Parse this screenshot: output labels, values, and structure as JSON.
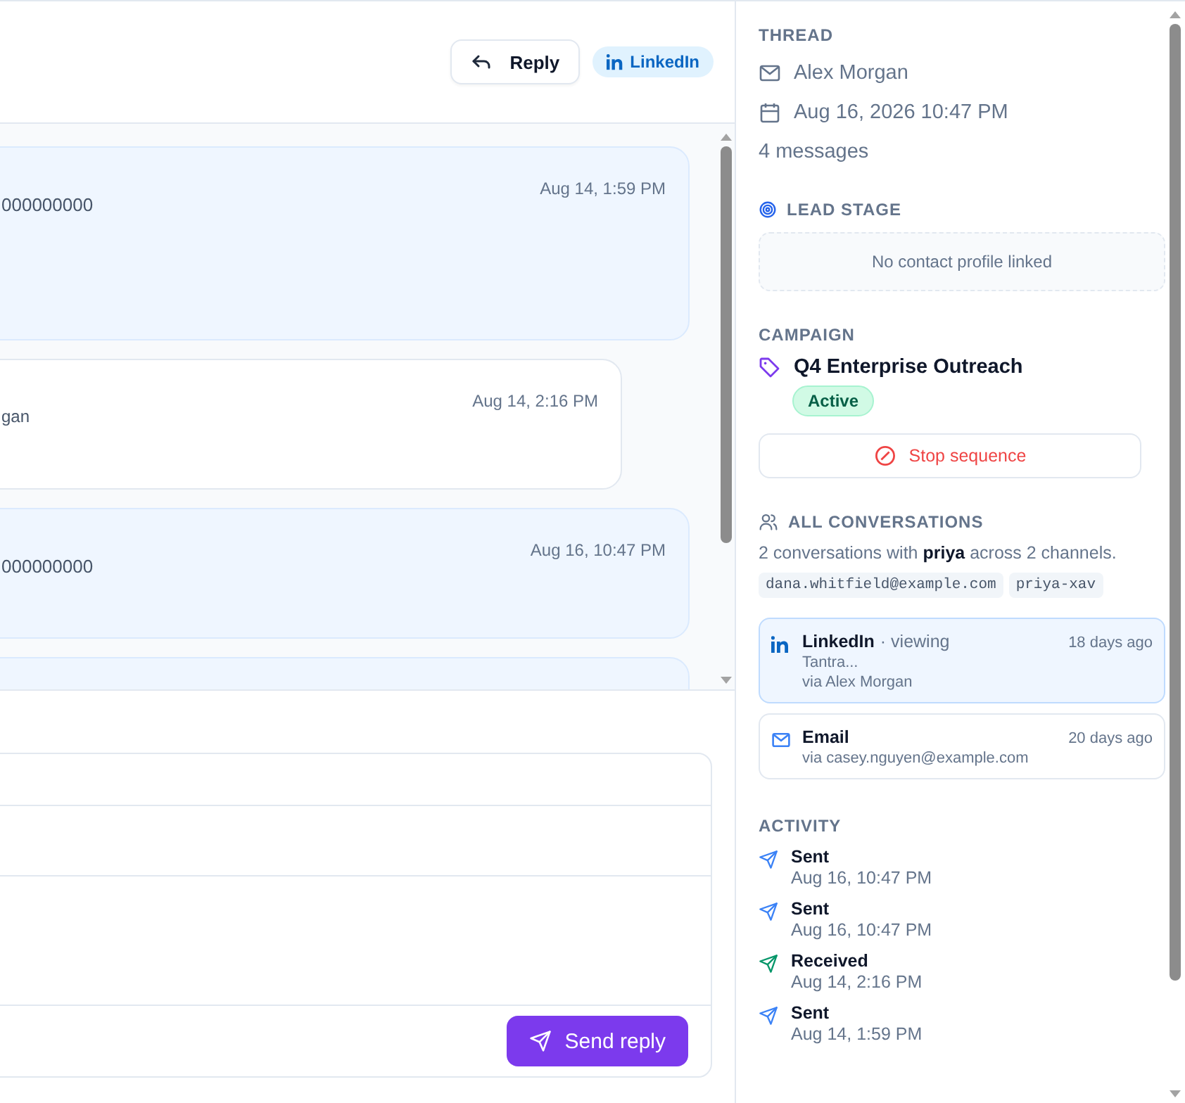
{
  "header": {
    "reply_button": "Reply",
    "channel_badge": "LinkedIn"
  },
  "messages": [
    {
      "kind": "outgoing",
      "text": "000000000",
      "time": "Aug 14, 1:59 PM"
    },
    {
      "kind": "incoming",
      "text": "gan",
      "time": "Aug 14, 2:16 PM"
    },
    {
      "kind": "outgoing",
      "text": "000000000",
      "time": "Aug 16, 10:47 PM"
    },
    {
      "kind": "outgoing"
    }
  ],
  "composer": {
    "send_button": "Send reply"
  },
  "thread": {
    "title": "THREAD",
    "sender": "Alex Morgan",
    "date": "Aug 16, 2026 10:47 PM",
    "count": "4 messages"
  },
  "lead_stage": {
    "title": "LEAD STAGE",
    "empty_text": "No contact profile linked"
  },
  "campaign": {
    "title": "CAMPAIGN",
    "name": "Q4 Enterprise Outreach",
    "status": "Active",
    "stop_button": "Stop sequence"
  },
  "conversations": {
    "title": "ALL CONVERSATIONS",
    "summary": "2 conversations with **priya** across 2 channels.",
    "handles": [
      "dana.whitfield@example.com",
      "priya-xav"
    ],
    "items": [
      {
        "kind": "linkedin",
        "channel": "LinkedIn",
        "note": "· viewing",
        "preview": "Tantra...",
        "via": "via Alex Morgan",
        "age": "18 days ago",
        "selected": true
      },
      {
        "kind": "email",
        "channel": "Email",
        "via": "via casey.nguyen@example.com",
        "age": "20 days ago",
        "selected": false
      }
    ]
  },
  "activity": {
    "title": "ACTIVITY",
    "items": [
      {
        "kind": "sent",
        "label": "Sent",
        "time": "Aug 16, 10:47 PM"
      },
      {
        "kind": "sent",
        "label": "Sent",
        "time": "Aug 16, 10:47 PM"
      },
      {
        "kind": "received",
        "label": "Received",
        "time": "Aug 14, 2:16 PM"
      },
      {
        "kind": "sent",
        "label": "Sent",
        "time": "Aug 14, 1:59 PM"
      }
    ]
  }
}
